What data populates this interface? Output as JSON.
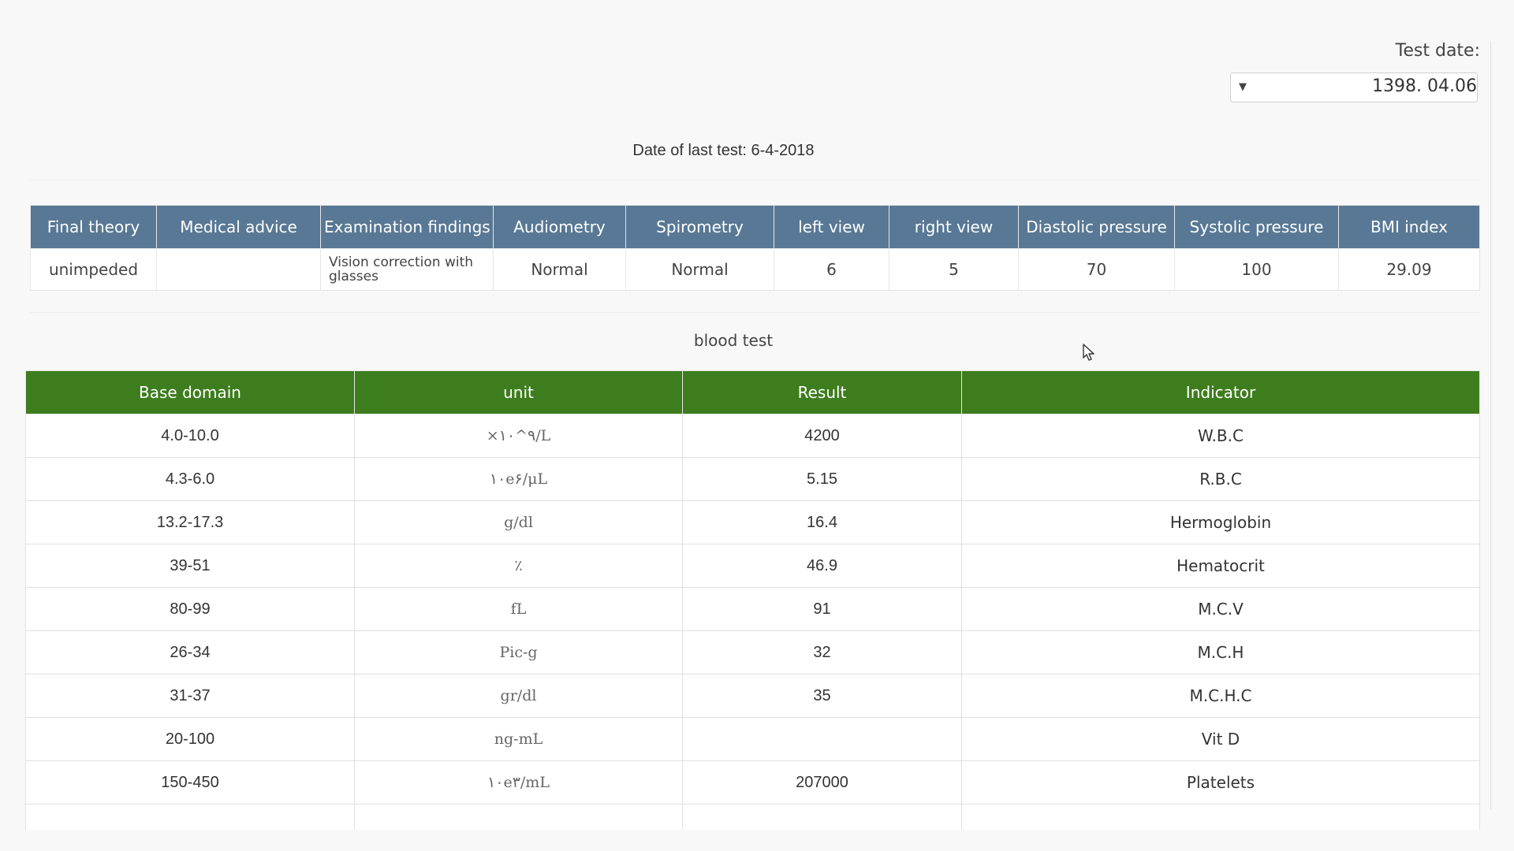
{
  "header": {
    "test_date_label": "Test date:",
    "test_date_value": "1398. 04.06",
    "last_test_text": "Date of last test: 6-4-2018"
  },
  "exam": {
    "columns": [
      "Final theory",
      "Medical advice",
      "Examination findings",
      "Audiometry",
      "Spirometry",
      "left view",
      "right view",
      "Diastolic pressure",
      "Systolic pressure",
      "BMI index"
    ],
    "row": [
      "unimpeded",
      "",
      "Vision correction with glasses",
      "Normal",
      "Normal",
      "6",
      "5",
      "70",
      "100",
      "29.09"
    ]
  },
  "blood": {
    "title": "blood test",
    "columns": [
      "Base domain",
      "unit",
      "Result",
      "Indicator"
    ],
    "rows": [
      [
        "4.0-10.0",
        "×۱۰^۹/L",
        "4200",
        "W.B.C"
      ],
      [
        "4.3-6.0",
        "۱۰e۶/μL",
        "5.15",
        "R.B.C"
      ],
      [
        "13.2-17.3",
        "g/dl",
        "16.4",
        "Hermoglobin"
      ],
      [
        "39-51",
        "٪",
        "46.9",
        "Hematocrit"
      ],
      [
        "80-99",
        "fL",
        "91",
        "M.C.V"
      ],
      [
        "26-34",
        "Pic-g",
        "32",
        "M.C.H"
      ],
      [
        "31-37",
        "gr/dl",
        "35",
        "M.C.H.C"
      ],
      [
        "20-100",
        "ng-mL",
        "",
        "Vit D"
      ],
      [
        "150-450",
        "۱۰e۳/mL",
        "207000",
        "Platelets"
      ]
    ]
  },
  "icons": {
    "dropdown": "chevron-down-icon",
    "cursor": "mouse-pointer-icon"
  },
  "colors": {
    "exam_header_bg": "#587895",
    "blood_header_bg": "#3e7d1e"
  }
}
